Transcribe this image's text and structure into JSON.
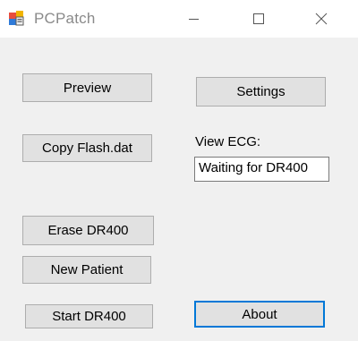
{
  "window": {
    "title": "PCPatch",
    "icon": "windows-forms-app-icon",
    "controls": [
      "minimize-icon",
      "maximize-icon",
      "close-icon"
    ]
  },
  "buttons": {
    "preview": "Preview",
    "settings": "Settings",
    "copy_flash": "Copy Flash.dat",
    "erase": "Erase DR400",
    "new_patient": "New Patient",
    "start": "Start DR400",
    "about": "About"
  },
  "view_ecg": {
    "label": "View ECG:",
    "value": "Waiting for DR400"
  },
  "colors": {
    "button_face": "#e1e1e1",
    "default_button_border": "#0078d7",
    "window_background": "#f0f0f0"
  }
}
